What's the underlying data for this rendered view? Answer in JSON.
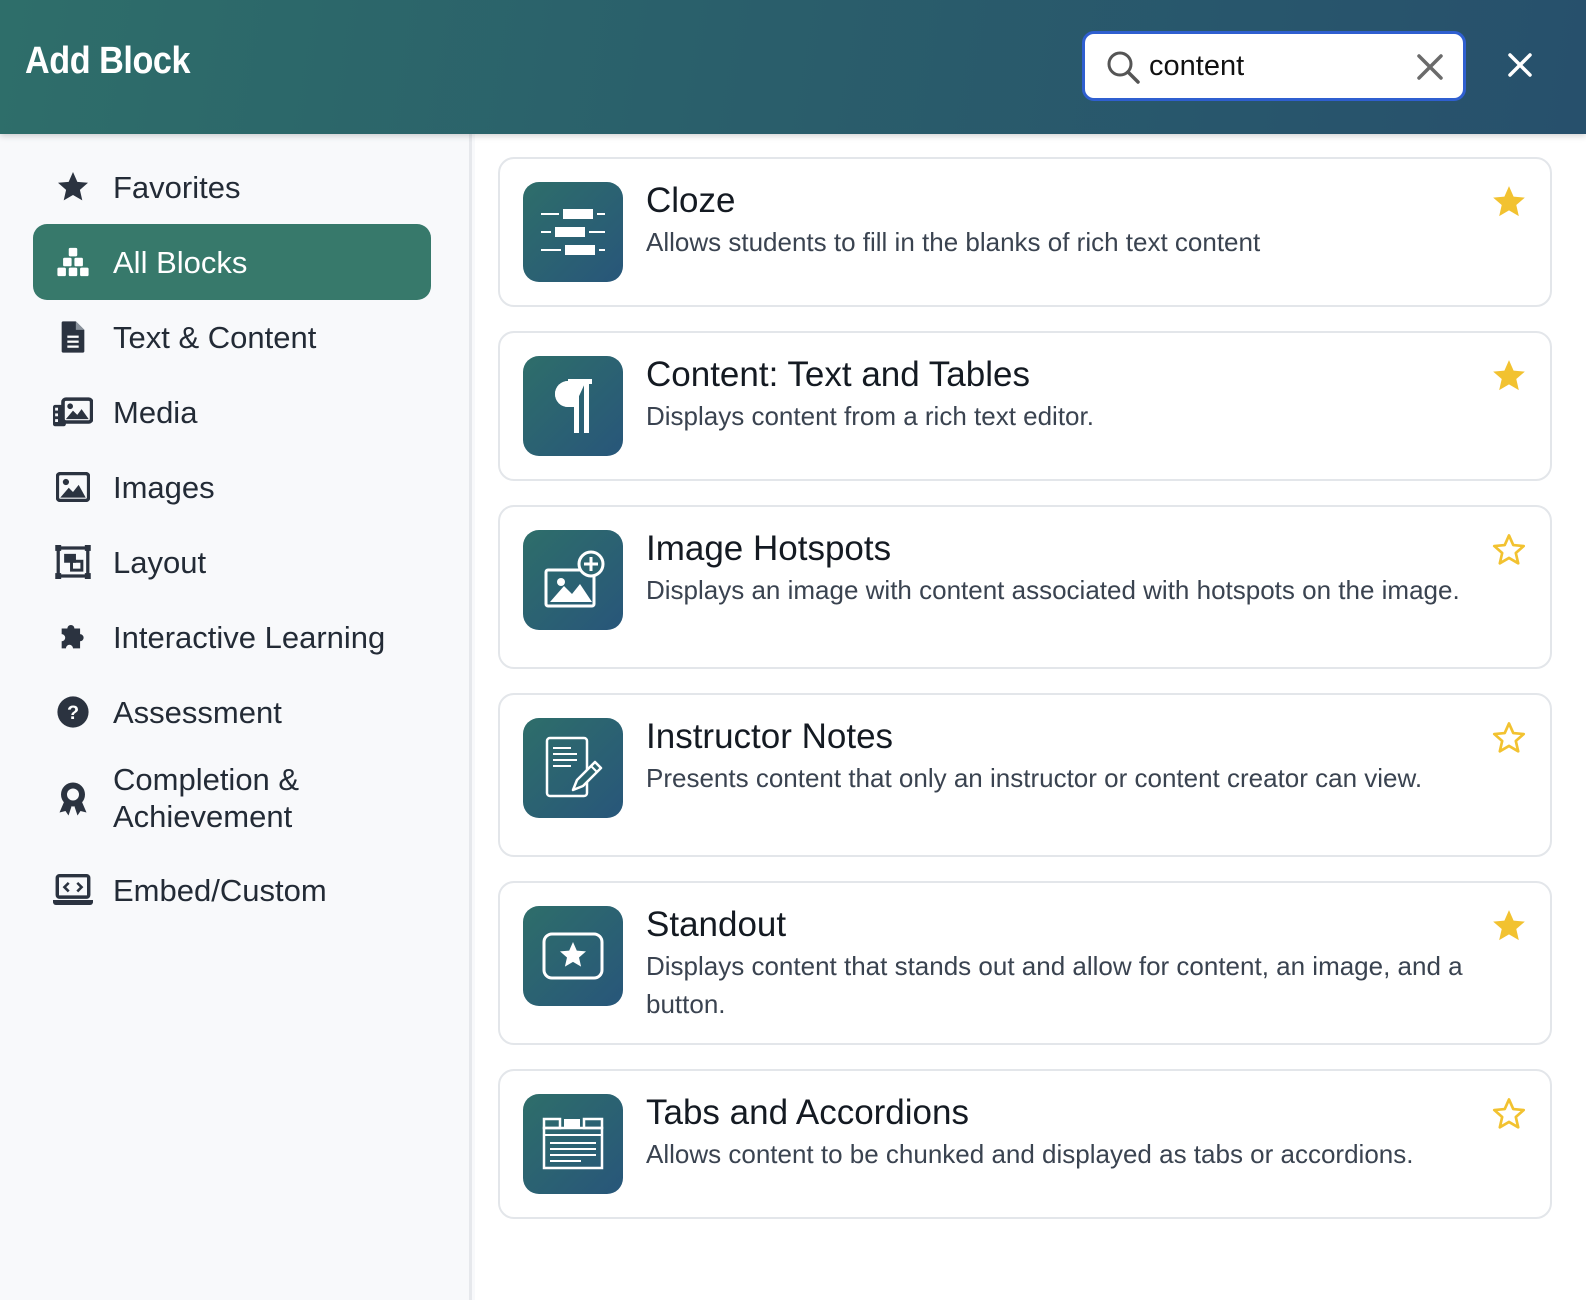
{
  "header": {
    "title": "Add Block",
    "search": {
      "value": "content",
      "placeholder": ""
    }
  },
  "sidebar": {
    "items": [
      {
        "label": "Favorites",
        "icon": "star-icon",
        "active": false
      },
      {
        "label": "All Blocks",
        "icon": "blocks-icon",
        "active": true
      },
      {
        "label": "Text & Content",
        "icon": "document-icon",
        "active": false
      },
      {
        "label": "Media",
        "icon": "media-icon",
        "active": false
      },
      {
        "label": "Images",
        "icon": "image-icon",
        "active": false
      },
      {
        "label": "Layout",
        "icon": "layout-icon",
        "active": false
      },
      {
        "label": "Interactive Learning",
        "icon": "puzzle-icon",
        "active": false
      },
      {
        "label": "Assessment",
        "icon": "question-circle-icon",
        "active": false
      },
      {
        "label": "Completion & Achievement",
        "label_line1": "Completion &",
        "label_line2": "Achievement",
        "icon": "award-icon",
        "active": false
      },
      {
        "label": "Embed/Custom",
        "icon": "laptop-code-icon",
        "active": false
      }
    ]
  },
  "blocks": [
    {
      "name": "Cloze",
      "description": "Allows students to fill in the blanks of rich text content",
      "icon": "cloze-icon",
      "favorite": true
    },
    {
      "name": "Content: Text and Tables",
      "description": "Displays content from a rich text editor.",
      "icon": "paragraph-icon",
      "favorite": true
    },
    {
      "name": "Image Hotspots",
      "description": "Displays an image with content associated with hotspots on the image.",
      "icon": "image-hotspot-icon",
      "favorite": false
    },
    {
      "name": "Instructor Notes",
      "description": "Presents content that only an instructor or content creator can view.",
      "icon": "notes-icon",
      "favorite": false
    },
    {
      "name": "Standout",
      "description": "Displays content that stands out and allow for content, an image, and a button.",
      "icon": "standout-star-icon",
      "favorite": true
    },
    {
      "name": "Tabs and Accordions",
      "description": "Allows content to be chunked and displayed as tabs or accordions.",
      "icon": "tabs-icon",
      "favorite": false
    }
  ],
  "colors": {
    "header_start": "#2e6e6a",
    "header_end": "#27506c",
    "active_nav": "#37796b",
    "favorite_star": "#f2c230",
    "focus_ring": "#2f5fd0"
  }
}
